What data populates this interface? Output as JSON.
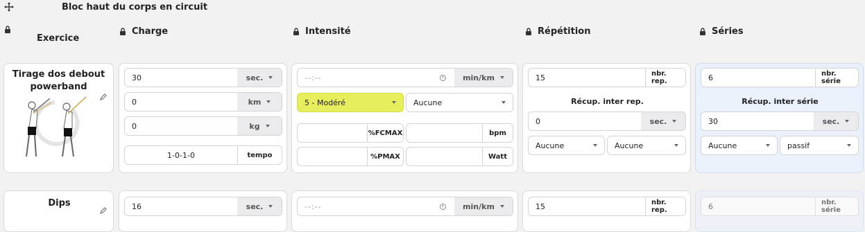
{
  "block": {
    "title": "Bloc haut du corps en circuit"
  },
  "headers": {
    "exercise": "Exercice",
    "load": "Charge",
    "intensity": "Intensité",
    "repetition": "Répétition",
    "series": "Séries"
  },
  "rows": [
    {
      "exercise_name": "Tirage dos debout powerband",
      "load": {
        "duration_value": "30",
        "duration_unit": "sec.",
        "distance_value": "0",
        "distance_unit": "km",
        "weight_value": "0",
        "weight_unit": "kg",
        "tempo_value": "1-0-1-0",
        "tempo_label": "tempo"
      },
      "intensity": {
        "pace_placeholder": "--:--",
        "pace_unit": "min/km",
        "level": "5 - Modéré",
        "level2": "Aucune",
        "fcmax_label": "%FCMAX",
        "bpm_label": "bpm",
        "pmax_label": "%PMAX",
        "watt_label": "Watt"
      },
      "repetition": {
        "reps_value": "15",
        "reps_unit": "nbr. rep.",
        "rest_label": "Récup. inter rep.",
        "rest_value": "0",
        "rest_unit": "sec.",
        "opt1": "Aucune",
        "opt2": "Aucune"
      },
      "series": {
        "sets_value": "6",
        "sets_unit": "nbr. série",
        "rest_label": "Récup. inter série",
        "rest_value": "30",
        "rest_unit": "sec.",
        "opt1": "Aucune",
        "opt2": "passif"
      }
    },
    {
      "exercise_name": "Dips",
      "load": {
        "duration_value": "16",
        "duration_unit": "sec."
      },
      "intensity": {
        "pace_placeholder": "--:--",
        "pace_unit": "min/km"
      },
      "repetition": {
        "reps_value": "15",
        "reps_unit": "nbr. rep."
      },
      "series": {
        "sets_value": "6",
        "sets_unit": "nbr. série"
      }
    }
  ]
}
